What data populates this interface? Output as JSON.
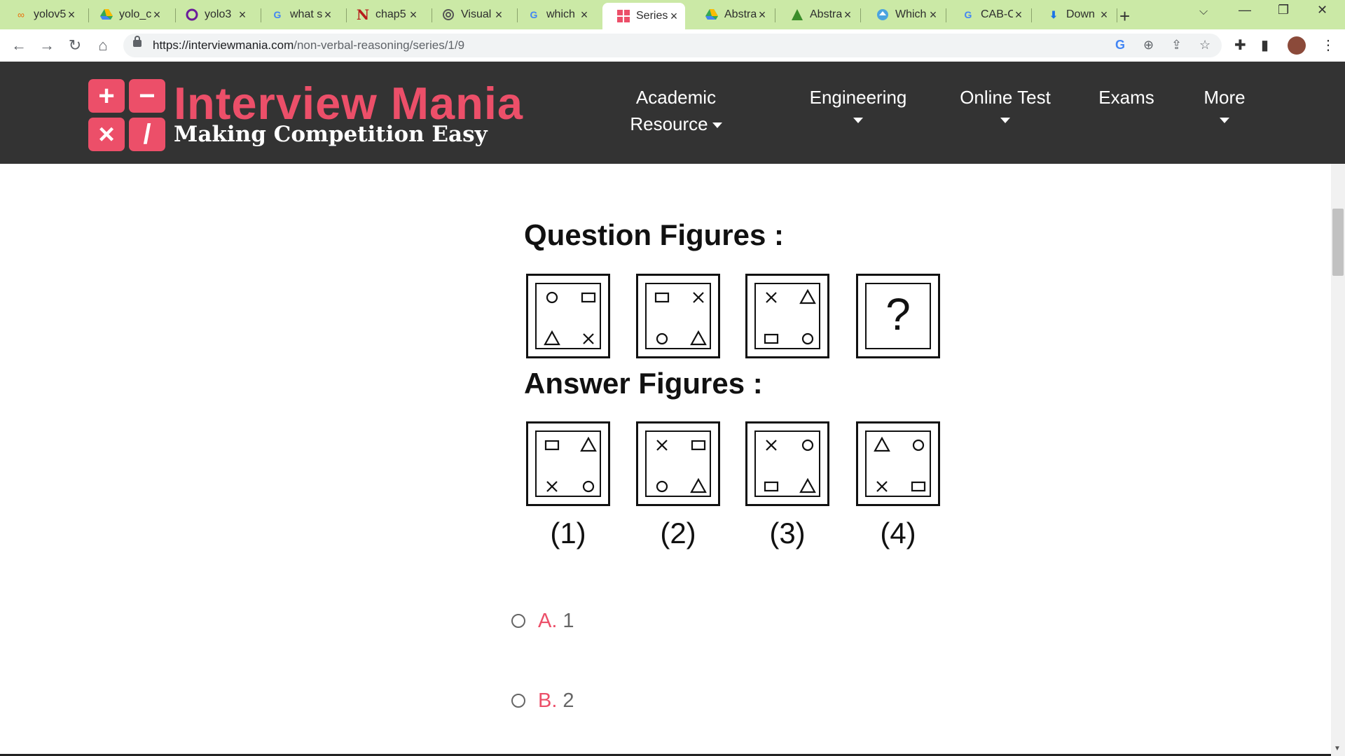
{
  "browser": {
    "tabs": [
      {
        "title": "yolov5",
        "icon": "colab-icon",
        "active": false
      },
      {
        "title": "yolo_c",
        "icon": "google-drive-icon",
        "active": false
      },
      {
        "title": "yolo3",
        "icon": "tab-swirl-icon",
        "active": false
      },
      {
        "title": "what s",
        "icon": "google-icon",
        "active": false
      },
      {
        "title": "chap5",
        "icon": "n-letter-icon",
        "active": false
      },
      {
        "title": "Visual",
        "icon": "openai-icon",
        "active": false
      },
      {
        "title": "which",
        "icon": "google-icon",
        "active": false
      },
      {
        "title": "Series",
        "icon": "interviewmania-icon",
        "active": true
      },
      {
        "title": "Abstra",
        "icon": "google-drive-icon",
        "active": false
      },
      {
        "title": "Abstra",
        "icon": "android-icon",
        "active": false
      },
      {
        "title": "Which",
        "icon": "upload-icon",
        "active": false
      },
      {
        "title": "CAB-C",
        "icon": "google-icon",
        "active": false
      },
      {
        "title": "Down",
        "icon": "download-icon",
        "active": false
      }
    ],
    "url_host": "https://interviewmania.com",
    "url_path": "/non-verbal-reasoning/series/1/9",
    "tab_strip_color": "#cbe9a6"
  },
  "site": {
    "brand_title": "Interview Mania",
    "brand_tagline": "Making Competition Easy",
    "brand_color": "#ec4f69",
    "logo_symbols": [
      "+",
      "−",
      "×",
      "/"
    ],
    "nav": [
      {
        "label_line1": "Academic",
        "label_line2": "Resource",
        "dropdown": true
      },
      {
        "label": "Engineering",
        "dropdown": true
      },
      {
        "label": "Online Test",
        "dropdown": true
      },
      {
        "label": "Exams",
        "dropdown": false
      },
      {
        "label": "More",
        "dropdown": true
      }
    ]
  },
  "question": {
    "question_title": "Question Figures :",
    "answer_title": "Answer Figures :",
    "question_mark": "?",
    "question_figures": [
      {
        "top_left": "circle",
        "top_right": "square",
        "bottom_left": "triangle",
        "bottom_right": "cross"
      },
      {
        "top_left": "square",
        "top_right": "cross",
        "bottom_left": "circle",
        "bottom_right": "triangle"
      },
      {
        "top_left": "cross",
        "top_right": "triangle",
        "bottom_left": "square",
        "bottom_right": "circle"
      }
    ],
    "answer_figures": [
      {
        "label": "(1)",
        "top_left": "square",
        "top_right": "triangle",
        "bottom_left": "cross",
        "bottom_right": "circle"
      },
      {
        "label": "(2)",
        "top_left": "cross",
        "top_right": "square",
        "bottom_left": "circle",
        "bottom_right": "triangle"
      },
      {
        "label": "(3)",
        "top_left": "cross",
        "top_right": "circle",
        "bottom_left": "square",
        "bottom_right": "triangle"
      },
      {
        "label": "(4)",
        "top_left": "triangle",
        "top_right": "circle",
        "bottom_left": "cross",
        "bottom_right": "square"
      }
    ],
    "options": [
      {
        "letter": "A.",
        "value": "1"
      },
      {
        "letter": "B.",
        "value": "2"
      }
    ]
  }
}
